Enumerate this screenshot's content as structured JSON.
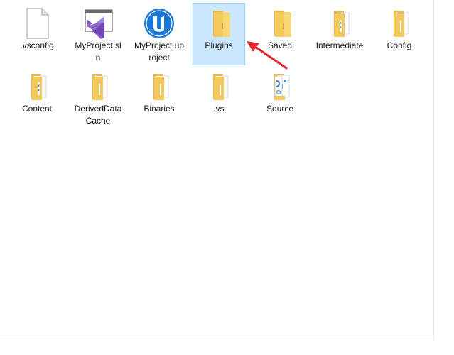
{
  "items": [
    {
      "label": ".vsconfig",
      "icon": "file-icon"
    },
    {
      "label": "MyProject.sln",
      "icon": "visual-studio-solution-icon"
    },
    {
      "label": "MyProject.uproject",
      "icon": "unreal-engine-icon"
    },
    {
      "label": "Plugins",
      "icon": "folder-icon",
      "selected": true
    },
    {
      "label": "Saved",
      "icon": "folder-icon"
    },
    {
      "label": "Intermediate",
      "icon": "folder-with-files-icon"
    },
    {
      "label": "Config",
      "icon": "folder-with-files-icon"
    },
    {
      "label": "Content",
      "icon": "folder-with-files-icon"
    },
    {
      "label": "DerivedDataCache",
      "icon": "folder-with-files-icon"
    },
    {
      "label": "Binaries",
      "icon": "folder-with-files-icon"
    },
    {
      "label": ".vs",
      "icon": "folder-with-files-icon"
    },
    {
      "label": "Source",
      "icon": "folder-with-source-files-icon"
    }
  ],
  "colors": {
    "selection_fill": "#cce8ff",
    "selection_border": "#99d1ff",
    "folder": "#f8d775",
    "folder_dark": "#e8b84a",
    "annotation": "#e0282f",
    "unreal_blue": "#1c77d2",
    "vs_purple": "#8661c5"
  }
}
